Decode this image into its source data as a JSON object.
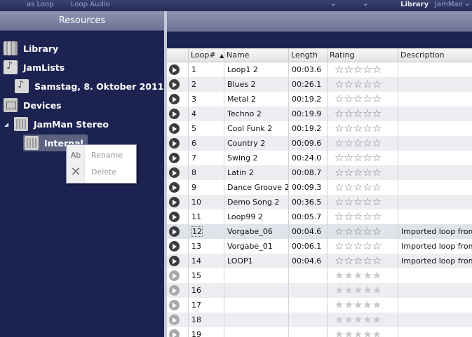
{
  "topbar": {
    "item1": "as Loop",
    "item2": "Loop Audio",
    "library": "Library",
    "device": "JamMan"
  },
  "resources": {
    "title": "Resources",
    "tree": [
      {
        "label": "Library",
        "icon": "library-icon"
      },
      {
        "label": "JamLists",
        "icon": "jamlist-icon"
      },
      {
        "label": "Samstag, 8. Oktober 2011",
        "icon": "playlist-note-icon"
      },
      {
        "label": "Devices",
        "icon": "devices-icon"
      },
      {
        "label": "JamMan Stereo",
        "icon": "jamman-device-icon"
      },
      {
        "label": "Internal",
        "icon": "internal-storage-icon"
      }
    ]
  },
  "context_menu": {
    "rename": "Rename",
    "delete": "Delete"
  },
  "table": {
    "columns": [
      "Loop#",
      "Name",
      "Length",
      "Rating",
      "Description"
    ],
    "sort_indicator": "▲",
    "stars_filled": "☆☆☆☆☆",
    "stars_empty": "★★★★★",
    "rows": [
      {
        "num": "1",
        "name": "Loop1 2",
        "length": "00:03.6",
        "desc": ""
      },
      {
        "num": "2",
        "name": "Blues 2",
        "length": "00:26.1",
        "desc": ""
      },
      {
        "num": "3",
        "name": "Metal 2",
        "length": "00:19.2",
        "desc": ""
      },
      {
        "num": "4",
        "name": "Techno 2",
        "length": "00:19.9",
        "desc": ""
      },
      {
        "num": "5",
        "name": "Cool Funk 2",
        "length": "00:19.2",
        "desc": ""
      },
      {
        "num": "6",
        "name": "Country 2",
        "length": "00:09.6",
        "desc": ""
      },
      {
        "num": "7",
        "name": "Swing 2",
        "length": "00:24.0",
        "desc": ""
      },
      {
        "num": "8",
        "name": "Latin 2",
        "length": "00:08.7",
        "desc": ""
      },
      {
        "num": "9",
        "name": "Dance Groove 2",
        "length": "00:09.3",
        "desc": ""
      },
      {
        "num": "10",
        "name": "Demo Song 2",
        "length": "00:36.5",
        "desc": ""
      },
      {
        "num": "11",
        "name": "Loop99 2",
        "length": "00:05.7",
        "desc": ""
      },
      {
        "num": "12",
        "name": "Vorgabe_06",
        "length": "00:04.6",
        "desc": "Imported loop from ."
      },
      {
        "num": "13",
        "name": "Vorgabe_01",
        "length": "00:06.1",
        "desc": "Imported loop from ."
      },
      {
        "num": "14",
        "name": "LOOP1",
        "length": "00:04.6",
        "desc": "Imported loop from ."
      },
      {
        "num": "15",
        "name": "",
        "length": "",
        "desc": ""
      },
      {
        "num": "16",
        "name": "",
        "length": "",
        "desc": ""
      },
      {
        "num": "17",
        "name": "",
        "length": "",
        "desc": ""
      },
      {
        "num": "18",
        "name": "",
        "length": "",
        "desc": ""
      },
      {
        "num": "19",
        "name": "",
        "length": "",
        "desc": ""
      }
    ]
  }
}
